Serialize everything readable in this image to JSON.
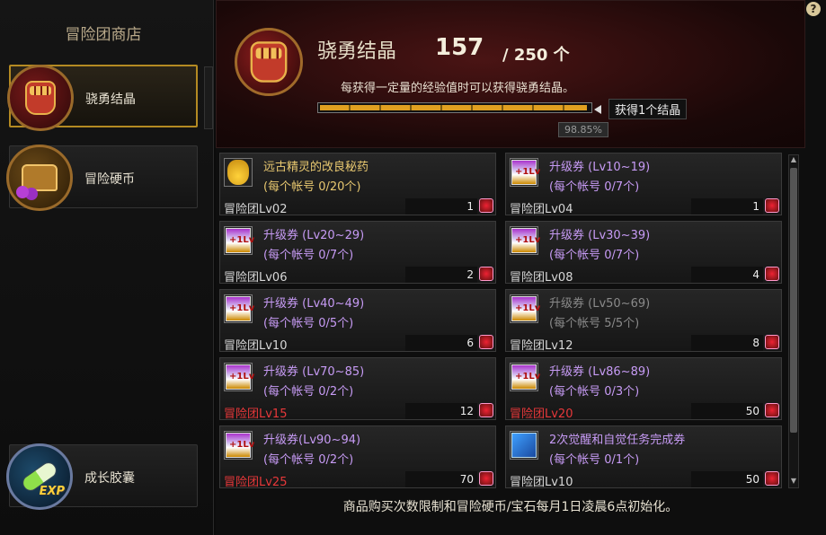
{
  "sidebar": {
    "title": "冒险团商店",
    "items": [
      {
        "label": "骁勇结晶",
        "icon": "fist-crystal-icon",
        "active": true
      },
      {
        "label": "冒险硬币",
        "icon": "treasure-chest-icon",
        "active": false
      },
      {
        "label": "成长胶囊",
        "icon": "exp-capsule-icon",
        "active": false
      }
    ]
  },
  "header": {
    "title": "骁勇结晶",
    "count": "157",
    "max": "/ 250 个",
    "description": "每获得一定量的经验值时可以获得骁勇结晶。",
    "progress_label": "获得1个结晶",
    "progress_percent_text": "98.85%",
    "progress_fraction": 0.9885,
    "help": "?"
  },
  "items": [
    {
      "name": "远古精灵的改良秘药",
      "limit": "(每个帐号 0/20个)",
      "req": "冒险团Lv02",
      "price": "1",
      "icon": "potion-icon",
      "style": "gold",
      "req_red": false
    },
    {
      "name": "升级券 (Lv10~19)",
      "limit": "(每个帐号 0/7个)",
      "req": "冒险团Lv04",
      "price": "1",
      "icon": "levelup-ticket-icon",
      "style": "normal",
      "req_red": false
    },
    {
      "name": "升级券 (Lv20~29)",
      "limit": "(每个帐号 0/7个)",
      "req": "冒险团Lv06",
      "price": "2",
      "icon": "levelup-ticket-icon",
      "style": "normal",
      "req_red": false
    },
    {
      "name": "升级券 (Lv30~39)",
      "limit": "(每个帐号 0/7个)",
      "req": "冒险团Lv08",
      "price": "4",
      "icon": "levelup-ticket-icon",
      "style": "normal",
      "req_red": false
    },
    {
      "name": "升级券 (Lv40~49)",
      "limit": "(每个帐号 0/5个)",
      "req": "冒险团Lv10",
      "price": "6",
      "icon": "levelup-ticket-icon",
      "style": "normal",
      "req_red": false
    },
    {
      "name": "升级券 (Lv50~69)",
      "limit": "(每个帐号 5/5个)",
      "req": "冒险团Lv12",
      "price": "8",
      "icon": "levelup-ticket-icon",
      "style": "dim",
      "req_red": false
    },
    {
      "name": "升级券 (Lv70~85)",
      "limit": "(每个帐号 0/2个)",
      "req": "冒险团Lv15",
      "price": "12",
      "icon": "levelup-ticket-icon",
      "style": "normal",
      "req_red": true
    },
    {
      "name": "升级券 (Lv86~89)",
      "limit": "(每个帐号 0/3个)",
      "req": "冒险团Lv20",
      "price": "50",
      "icon": "levelup-ticket-icon",
      "style": "normal",
      "req_red": true
    },
    {
      "name": "升级券(Lv90~94)",
      "limit": "(每个帐号 0/2个)",
      "req": "冒险团Lv25",
      "price": "70",
      "icon": "levelup-ticket-icon",
      "style": "normal",
      "req_red": true
    },
    {
      "name": "2次觉醒和自觉任务完成券",
      "limit": "(每个帐号 0/1个)",
      "req": "冒险团Lv10",
      "price": "50",
      "icon": "quest-ticket-icon",
      "style": "normal",
      "req_red": false
    }
  ],
  "footer": "商品购买次数限制和冒险硬币/宝石每月1日凌晨6点初始化。",
  "colors": {
    "accent_gold": "#b48a22",
    "item_purple": "#c79bf5",
    "req_red": "#e8383a"
  }
}
